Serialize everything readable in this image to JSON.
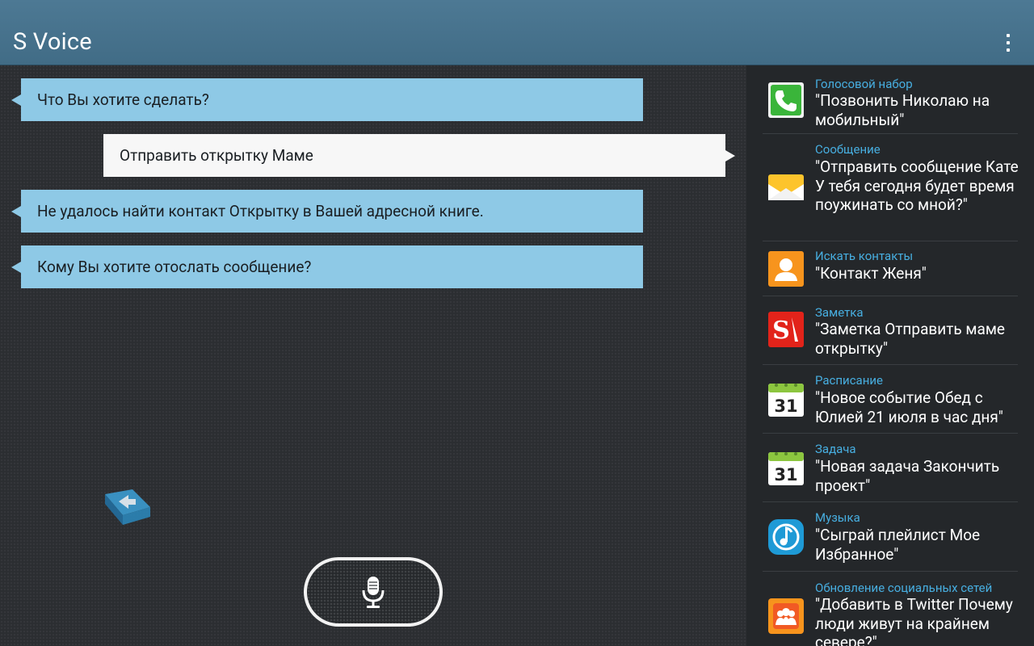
{
  "app": {
    "title": "S Voice"
  },
  "conversation": [
    {
      "role": "system",
      "text": "Что Вы хотите сделать?"
    },
    {
      "role": "user",
      "text": "Отправить открытку Маме"
    },
    {
      "role": "system",
      "text": "Не удалось найти контакт Открытку в Вашей адресной книге."
    },
    {
      "role": "system",
      "text": "Кому Вы хотите отослать сообщение?"
    }
  ],
  "hints": [
    {
      "category": "Голосовой набор",
      "text": "\"Позвонить Николаю на мобильный\"",
      "icon": "phone-icon"
    },
    {
      "category": "Сообщение",
      "text": "\"Отправить сообщение Кате У тебя сегодня будет время поужинать со мной?\"",
      "icon": "envelope-icon"
    },
    {
      "category": "Искать контакты",
      "text": "\"Контакт Женя\"",
      "icon": "contact-icon"
    },
    {
      "category": "Заметка",
      "text": "\"Заметка Отправить маме открытку\"",
      "icon": "memo-icon"
    },
    {
      "category": "Расписание",
      "text": "\"Новое событие Обед с Юлией 21 июля в час дня\"",
      "icon": "calendar-icon"
    },
    {
      "category": "Задача",
      "text": "\"Новая задача Закончить проект\"",
      "icon": "task-calendar-icon"
    },
    {
      "category": "Музыка",
      "text": "\"Сыграй плейлист Мое Избранное\"",
      "icon": "music-icon"
    },
    {
      "category": "Обновление социальных сетей",
      "text": "\"Добавить в Twitter Почему люди живут на крайнем севере?\"",
      "icon": "social-icon"
    }
  ],
  "calendar_day": "31",
  "colors": {
    "appbar": "#45708a",
    "system_bubble": "#8ec9e6",
    "user_bubble": "#f7f7f7",
    "hint_category": "#47aee0"
  }
}
